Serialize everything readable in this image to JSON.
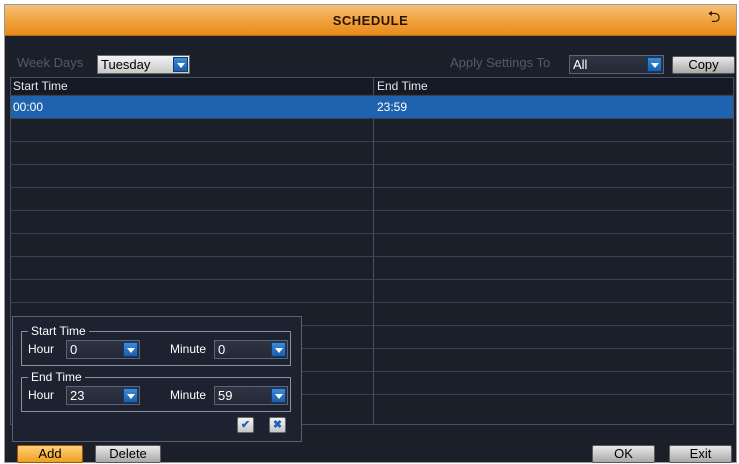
{
  "window": {
    "title": "SCHEDULE"
  },
  "filters": {
    "week_days_label": "Week Days",
    "week_days_value": "Tuesday",
    "apply_label": "Apply Settings To",
    "apply_value": "All",
    "copy_label": "Copy"
  },
  "table": {
    "columns": [
      "Start Time",
      "End Time"
    ],
    "rows": [
      {
        "start": "00:00",
        "end": "23:59",
        "selected": true
      }
    ]
  },
  "editor": {
    "start_group": "Start Time",
    "end_group": "End Time",
    "hour_label": "Hour",
    "minute_label": "Minute",
    "start_hour": "0",
    "start_minute": "0",
    "end_hour": "23",
    "end_minute": "59",
    "confirm_icon": "check-icon",
    "cancel_icon": "x-icon"
  },
  "footer": {
    "add_label": "Add",
    "delete_label": "Delete",
    "ok_label": "OK",
    "exit_label": "Exit"
  },
  "colors": {
    "title_bar": "#f0a03a",
    "selected_row": "#1f63ae",
    "panel": "#1b1f2a"
  }
}
